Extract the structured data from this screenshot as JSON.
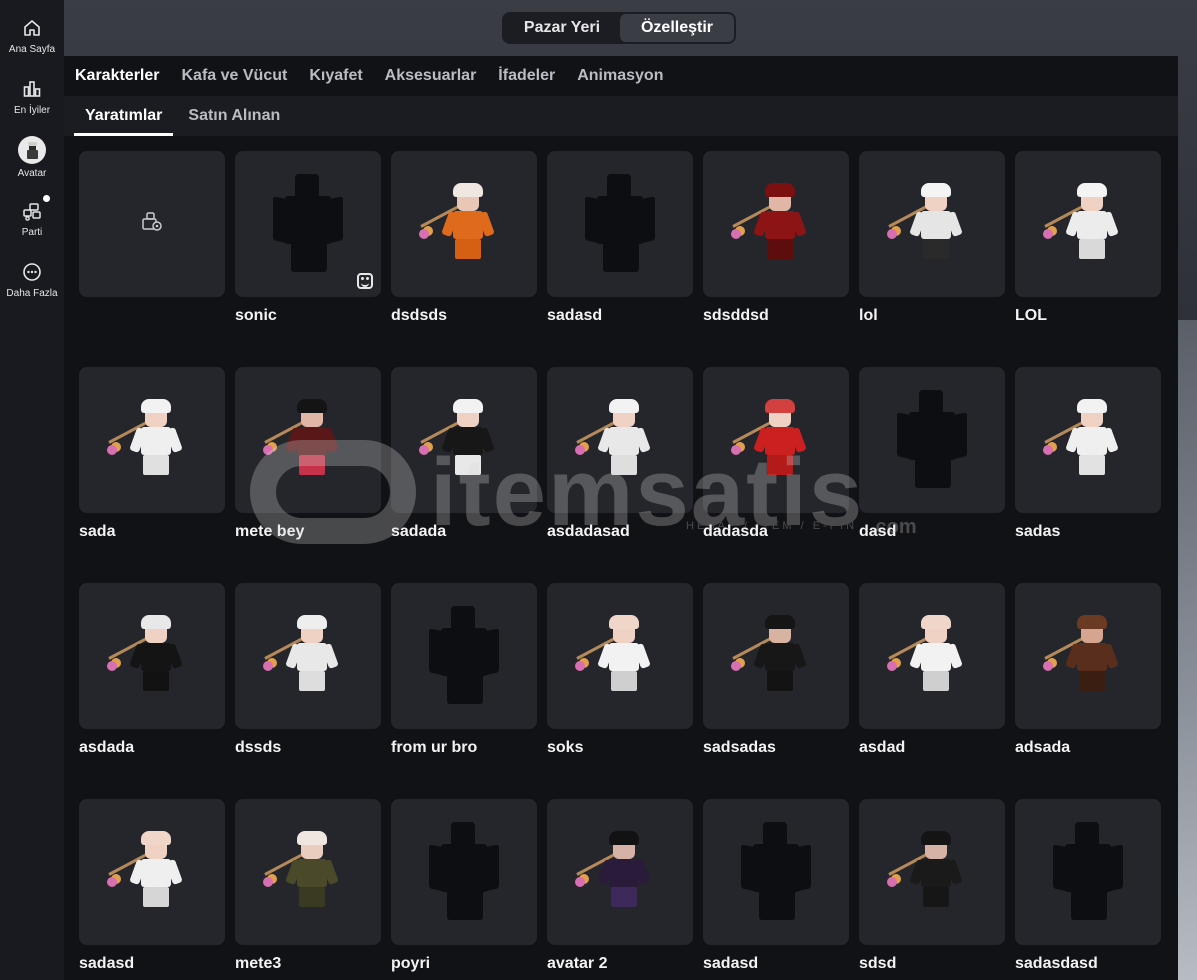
{
  "nav": {
    "items": [
      {
        "label": "Ana Sayfa",
        "icon": "home-icon"
      },
      {
        "label": "En İyiler",
        "icon": "chart-icon"
      },
      {
        "label": "Avatar",
        "icon": "avatar-icon"
      },
      {
        "label": "Parti",
        "icon": "party-icon"
      },
      {
        "label": "Daha Fazla",
        "icon": "more-icon"
      }
    ]
  },
  "segment": {
    "marketplace": "Pazar Yeri",
    "customize": "Özelleştir",
    "selected": "Özelleştir"
  },
  "tabs": {
    "primary": [
      "Karakterler",
      "Kafa ve Vücut",
      "Kıyafet",
      "Aksesuarlar",
      "İfadeler",
      "Animasyon"
    ],
    "primary_active": "Karakterler",
    "secondary": [
      "Yaratımlar",
      "Satın Alınan"
    ],
    "secondary_active": "Yaratımlar"
  },
  "characters": [
    {
      "name": "",
      "kind": "create"
    },
    {
      "name": "sonic",
      "kind": "blank",
      "badge": "emote-icon"
    },
    {
      "name": "dsdsds",
      "kind": "avatar",
      "skin": "#e9c7b6",
      "hair": "#efe7e0",
      "body": "#e06a1b",
      "legs": "#d55f12"
    },
    {
      "name": "sadasd",
      "kind": "blank"
    },
    {
      "name": "sdsddsd",
      "kind": "avatar",
      "skin": "#e2b6a6",
      "hair": "#7a1010",
      "body": "#8c1414",
      "legs": "#5e0d0d"
    },
    {
      "name": "lol",
      "kind": "avatar",
      "skin": "#f0d2c4",
      "hair": "#f4f4f4",
      "body": "#e5e5e5",
      "legs": "#2a2a2a"
    },
    {
      "name": "LOL",
      "kind": "avatar",
      "skin": "#f0d2c4",
      "hair": "#f4f4f4",
      "body": "#ececec",
      "legs": "#d9d9d9"
    },
    {
      "name": "sada",
      "kind": "avatar",
      "skin": "#f0d2c4",
      "hair": "#f2f2f2",
      "body": "#efefef",
      "legs": "#e0e0e0"
    },
    {
      "name": "mete bey",
      "kind": "avatar",
      "skin": "#e2b6a6",
      "hair": "#141414",
      "body": "#5a1717",
      "legs": "#c6324a"
    },
    {
      "name": "sadada",
      "kind": "avatar",
      "skin": "#f0d2c4",
      "hair": "#f2f2f2",
      "body": "#171717",
      "legs": "#e8e8e8"
    },
    {
      "name": "asdadasad",
      "kind": "avatar",
      "skin": "#f0d2c4",
      "hair": "#f2f2f2",
      "body": "#e8e8e8",
      "legs": "#dedede"
    },
    {
      "name": "dadasda",
      "kind": "avatar",
      "skin": "#f0d2c4",
      "hair": "#d24040",
      "body": "#cc1f1f",
      "legs": "#b31a1a"
    },
    {
      "name": "dasd",
      "kind": "blank"
    },
    {
      "name": "sadas",
      "kind": "avatar",
      "skin": "#f0d2c4",
      "hair": "#f2f2f2",
      "body": "#efefef",
      "legs": "#e2e2e2"
    },
    {
      "name": "asdada",
      "kind": "avatar",
      "skin": "#f0d2c4",
      "hair": "#e8e8e8",
      "body": "#141414",
      "legs": "#121212"
    },
    {
      "name": "dssds",
      "kind": "avatar",
      "skin": "#f0d2c4",
      "hair": "#eeeeee",
      "body": "#e8e8e8",
      "legs": "#dddddd"
    },
    {
      "name": "from ur bro",
      "kind": "blank"
    },
    {
      "name": "soks",
      "kind": "avatar",
      "skin": "#f0d2c4",
      "hair": "#f0d6c8",
      "body": "#f2f2f2",
      "legs": "#cfcfcf"
    },
    {
      "name": "sadsadas",
      "kind": "avatar",
      "skin": "#d9b3a2",
      "hair": "#151515",
      "body": "#171717",
      "legs": "#131313"
    },
    {
      "name": "asdad",
      "kind": "avatar",
      "skin": "#f0d2c4",
      "hair": "#f0d6c8",
      "body": "#f2f2f2",
      "legs": "#cfcfcf"
    },
    {
      "name": "adsada",
      "kind": "avatar",
      "skin": "#d6a58f",
      "hair": "#6b3a22",
      "body": "#5a2e1c",
      "legs": "#3a1e12"
    },
    {
      "name": "sadasd",
      "kind": "avatar",
      "skin": "#f0d2c4",
      "hair": "#f0d6c8",
      "body": "#efefef",
      "legs": "#d6d6d6"
    },
    {
      "name": "mete3",
      "kind": "avatar",
      "skin": "#e9cdbf",
      "hair": "#f0e6e0",
      "body": "#4a4a2a",
      "legs": "#3a3a22"
    },
    {
      "name": "poyri",
      "kind": "blank"
    },
    {
      "name": "avatar 2",
      "kind": "avatar",
      "skin": "#d6b2a6",
      "hair": "#121212",
      "body": "#2a1b3a",
      "legs": "#3d2a5a"
    },
    {
      "name": "sadasd",
      "kind": "blank"
    },
    {
      "name": "sdsd",
      "kind": "avatar",
      "skin": "#d6b2a6",
      "hair": "#141414",
      "body": "#1a1a1a",
      "legs": "#161616"
    },
    {
      "name": "sadasdasd",
      "kind": "blank"
    }
  ],
  "watermark": {
    "brand": "itemsatis",
    "tagline": "HESAP / İTEM / E-PİN",
    "domain": ".com"
  }
}
